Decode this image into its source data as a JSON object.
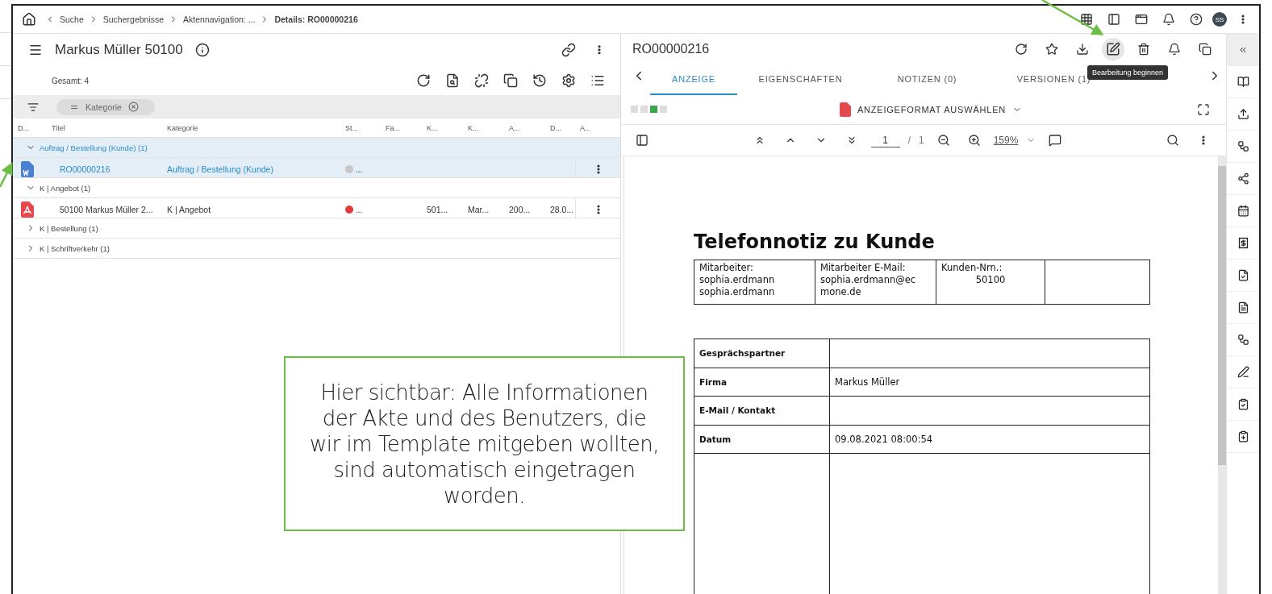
{
  "breadcrumbs": [
    {
      "label": "Suche",
      "current": false
    },
    {
      "label": "Suchergebnisse",
      "current": false
    },
    {
      "label": "Aktennavigation: ...",
      "current": false
    },
    {
      "label": "Details: RO00000216",
      "current": true
    }
  ],
  "user": {
    "initials": "SS"
  },
  "file_panel": {
    "title": "Markus Müller 50100",
    "total": "Gesamt: 4",
    "filter_chip": "Kategorie",
    "columns": [
      "D...",
      "Titel",
      "Kategorie",
      "St...",
      "Fa...",
      "K...",
      "K...",
      "A...",
      "D...",
      "A..."
    ],
    "rows": [
      {
        "kind": "group",
        "label": "Auftrag / Bestellung (Kunde) (1)",
        "expanded": true,
        "selected": true
      },
      {
        "kind": "word_document",
        "selected": true,
        "title": "RO00000216",
        "category": "Auftrag / Bestellung  (Kunde)",
        "status": "...",
        "color": "#c8c8c8",
        "cells": [
          null,
          null,
          null,
          null,
          null
        ]
      },
      {
        "kind": "group",
        "label": "K | Angebot (1)",
        "expanded": true,
        "selected": false
      },
      {
        "kind": "pdf_document",
        "selected": false,
        "title": "50100 Markus Müller 2...",
        "category": "K | Angebot",
        "status": "...",
        "color": "#e53935",
        "cells": [
          null,
          "501...",
          "Mar...",
          "200...",
          "28.0..."
        ]
      },
      {
        "kind": "group",
        "label": "K | Bestellung (1)",
        "expanded": false,
        "selected": false
      },
      {
        "kind": "group",
        "label": "K | Schriftverkehr (1)",
        "expanded": false,
        "selected": false
      }
    ]
  },
  "detail_panel": {
    "title": "RO00000216",
    "tooltip": "Bearbeitung beginnen",
    "tabs": [
      {
        "label": "ANZEIGE",
        "selected": true
      },
      {
        "label": "EIGENSCHAFTEN",
        "selected": false
      },
      {
        "label": "NOTIZEN (0)",
        "selected": false
      },
      {
        "label": "VERSIONEN (1)",
        "selected": false
      }
    ],
    "format_button": "ANZEIGEFORMAT AUSWÄHLEN",
    "page": "1",
    "page_separator": "/",
    "page_total": "1",
    "zoom": "159%",
    "document": {
      "heading": "Telefonnotiz zu Kunde",
      "header_table": [
        {
          "label": "Mitarbeiter:",
          "lines": [
            "sophia.erdmann",
            "sophia.erdmann"
          ]
        },
        {
          "label": "Mitarbeiter E-Mail:",
          "lines": [
            "sophia.erdmann@ec",
            "mone.de"
          ]
        },
        {
          "label": "Kunden-Nrn.:",
          "lines": [
            "50100"
          ]
        }
      ],
      "fields": [
        {
          "label": "Gesprächspartner"
        },
        {
          "label": "Firma",
          "value": "Markus Müller"
        },
        {
          "label": "E-Mail / Kontakt"
        },
        {
          "label": "Datum",
          "value": "09.08.2021 08:00:54"
        }
      ]
    }
  },
  "callout": "Hier sichtbar: Alle Informationen der Akte und des Benutzers, die wir im Template mitgeben wollten, sind automatisch eingetragen worden."
}
